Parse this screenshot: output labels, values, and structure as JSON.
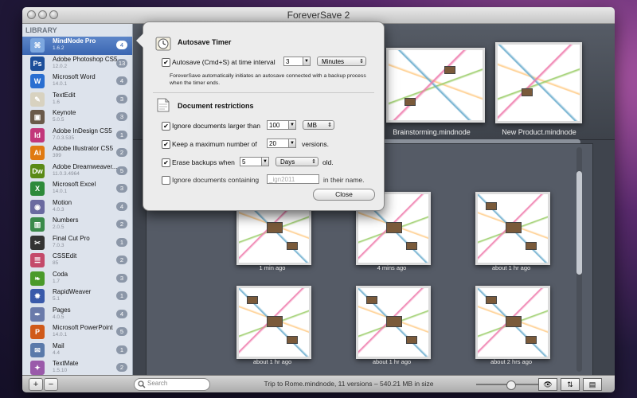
{
  "window": {
    "title": "ForeverSave 2"
  },
  "sidebar": {
    "header": "LIBRARY",
    "items": [
      {
        "name": "MindNode Pro",
        "version": "1.6.2",
        "count": "4",
        "icon": "mindnode-icon",
        "color": "#7ca7df",
        "glyph": "⌘"
      },
      {
        "name": "Adobe Photoshop CS5",
        "version": "12.0.2",
        "count": "13",
        "icon": "photoshop-icon",
        "color": "#1d4f9a",
        "glyph": "Ps"
      },
      {
        "name": "Microsoft Word",
        "version": "14.0.1",
        "count": "4",
        "icon": "word-icon",
        "color": "#2a6fd1",
        "glyph": "W"
      },
      {
        "name": "TextEdit",
        "version": "1.6",
        "count": "3",
        "icon": "textedit-icon",
        "color": "#d8d2c0",
        "glyph": "✎"
      },
      {
        "name": "Keynote",
        "version": "5.0.5",
        "count": "3",
        "icon": "keynote-icon",
        "color": "#6a5a4a",
        "glyph": "▣"
      },
      {
        "name": "Adobe InDesign CS5",
        "version": "7.0.3.535",
        "count": "1",
        "icon": "indesign-icon",
        "color": "#c2367a",
        "glyph": "Id"
      },
      {
        "name": "Adobe Illustrator CS5",
        "version": "399",
        "count": "2",
        "icon": "illustrator-icon",
        "color": "#e07a12",
        "glyph": "Ai"
      },
      {
        "name": "Adobe Dreamweaver...",
        "version": "11.0.3.4964",
        "count": "5",
        "icon": "dreamweaver-icon",
        "color": "#5a8a16",
        "glyph": "Dw"
      },
      {
        "name": "Microsoft Excel",
        "version": "14.0.1",
        "count": "3",
        "icon": "excel-icon",
        "color": "#2d8a3a",
        "glyph": "X"
      },
      {
        "name": "Motion",
        "version": "4.0.3",
        "count": "4",
        "icon": "motion-icon",
        "color": "#6a6aa0",
        "glyph": "◉"
      },
      {
        "name": "Numbers",
        "version": "2.0.5",
        "count": "2",
        "icon": "numbers-icon",
        "color": "#3a8a4a",
        "glyph": "▥"
      },
      {
        "name": "Final Cut Pro",
        "version": "7.0.3",
        "count": "1",
        "icon": "finalcut-icon",
        "color": "#333333",
        "glyph": "✂"
      },
      {
        "name": "CSSEdit",
        "version": "85",
        "count": "2",
        "icon": "cssedit-icon",
        "color": "#c44a6a",
        "glyph": "☰"
      },
      {
        "name": "Coda",
        "version": "1.7",
        "count": "3",
        "icon": "coda-icon",
        "color": "#4a9a2a",
        "glyph": "❧"
      },
      {
        "name": "RapidWeaver",
        "version": "5.1",
        "count": "1",
        "icon": "rapidweaver-icon",
        "color": "#3a5aaa",
        "glyph": "✹"
      },
      {
        "name": "Pages",
        "version": "4.0.5",
        "count": "4",
        "icon": "pages-icon",
        "color": "#6a7aaa",
        "glyph": "✒"
      },
      {
        "name": "Microsoft PowerPoint",
        "version": "14.0.1",
        "count": "5",
        "icon": "powerpoint-icon",
        "color": "#d05a1a",
        "glyph": "P"
      },
      {
        "name": "Mail",
        "version": "4.4",
        "count": "1",
        "icon": "mail-icon",
        "color": "#5a7aaa",
        "glyph": "✉"
      },
      {
        "name": "TextMate",
        "version": "1.5.10",
        "count": "2",
        "icon": "textmate-icon",
        "color": "#9a5aaa",
        "glyph": "✦"
      }
    ]
  },
  "shelf": {
    "items": [
      {
        "label": "Brainstorming.mindnode"
      },
      {
        "label": "New Product.mindnode"
      }
    ]
  },
  "versions": [
    {
      "label": "1 min ago"
    },
    {
      "label": "4 mins ago"
    },
    {
      "label": "about 1 hr ago"
    },
    {
      "label": "about 1 hr ago"
    },
    {
      "label": "about 1 hr ago"
    },
    {
      "label": "about 2 hrs ago"
    }
  ],
  "popover": {
    "autosave_title": "Autosave Timer",
    "autosave_label": "Autosave (Cmd+S) at time interval",
    "autosave_checked": "✔",
    "autosave_value": "3",
    "autosave_unit": "Minutes",
    "autosave_desc": "ForeverSave automatically initiates an autosave connected with a backup process when the timer ends.",
    "restrictions_title": "Document restrictions",
    "ignore_larger_label": "Ignore documents larger than",
    "ignore_larger_checked": "✔",
    "ignore_larger_value": "100",
    "ignore_larger_unit": "MB",
    "keep_max_label": "Keep a maximum number of",
    "keep_max_checked": "✔",
    "keep_max_value": "20",
    "keep_max_suffix": "versions.",
    "erase_label": "Erase backups when",
    "erase_checked": "✔",
    "erase_value": "5",
    "erase_unit": "Days",
    "erase_suffix": "old.",
    "ignore_containing_label": "Ignore documents containing",
    "ignore_containing_checked": "",
    "ignore_containing_placeholder": "_ign2011",
    "ignore_containing_suffix": "in their name.",
    "close_label": "Close"
  },
  "bottombar": {
    "add_label": "+",
    "remove_label": "−",
    "search_placeholder": "Search",
    "status": "Trip to Rome.mindnode, 11 versions – 540.21 MB in size",
    "preview_label": "👁",
    "restore_label": "⇅",
    "export_label": "▤"
  }
}
